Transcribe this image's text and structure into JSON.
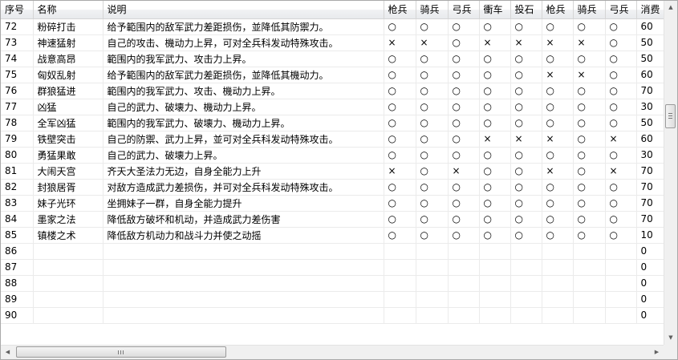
{
  "grid": {
    "columns": [
      "序号",
      "名称",
      "说明",
      "枪兵",
      "骑兵",
      "弓兵",
      "衝车",
      "投石",
      "枪兵",
      "骑兵",
      "弓兵",
      "消费"
    ],
    "rows": [
      [
        "72",
        "粉碎打击",
        "给予範围内的敌军武力差距损伤，並降低其防禦力。",
        "○",
        "○",
        "○",
        "○",
        "○",
        "○",
        "○",
        "○",
        "60"
      ],
      [
        "73",
        "神速猛射",
        "自己的攻击、機动力上昇，可对全兵科发动特殊攻击。",
        "×",
        "×",
        "○",
        "×",
        "×",
        "×",
        "×",
        "○",
        "50"
      ],
      [
        "74",
        "战意高昂",
        "範围内的我军武力、攻击力上昇。",
        "○",
        "○",
        "○",
        "○",
        "○",
        "○",
        "○",
        "○",
        "50"
      ],
      [
        "75",
        "匈奴乱射",
        "给予範围内的敌军武力差距损伤，並降低其機动力。",
        "○",
        "○",
        "○",
        "○",
        "○",
        "×",
        "×",
        "○",
        "60"
      ],
      [
        "76",
        "群狼猛进",
        "範围内的我军武力、攻击、機动力上昇。",
        "○",
        "○",
        "○",
        "○",
        "○",
        "○",
        "○",
        "○",
        "70"
      ],
      [
        "77",
        "凶猛",
        "自己的武力、破壊力、機动力上昇。",
        "○",
        "○",
        "○",
        "○",
        "○",
        "○",
        "○",
        "○",
        "30"
      ],
      [
        "78",
        "全军凶猛",
        "範围内的我军武力、破壊力、機动力上昇。",
        "○",
        "○",
        "○",
        "○",
        "○",
        "○",
        "○",
        "○",
        "50"
      ],
      [
        "79",
        "铁壁突击",
        "自己的防禦、武力上昇，並可对全兵科发动特殊攻击。",
        "○",
        "○",
        "○",
        "×",
        "×",
        "×",
        "○",
        "×",
        "60"
      ],
      [
        "80",
        "勇猛果敢",
        "自己的武力、破壊力上昇。",
        "○",
        "○",
        "○",
        "○",
        "○",
        "○",
        "○",
        "○",
        "30"
      ],
      [
        "81",
        "大闹天宫",
        "齐天大圣法力无边，自身全能力上升",
        "×",
        "○",
        "×",
        "○",
        "○",
        "×",
        "○",
        "×",
        "70"
      ],
      [
        "82",
        "封狼居胥",
        "对敌方造成武力差损伤，并可对全兵科发动特殊攻击。",
        "○",
        "○",
        "○",
        "○",
        "○",
        "○",
        "○",
        "○",
        "70"
      ],
      [
        "83",
        "妹子光环",
        "坐拥妹子一群，自身全能力提升",
        "○",
        "○",
        "○",
        "○",
        "○",
        "○",
        "○",
        "○",
        "70"
      ],
      [
        "84",
        "墨家之法",
        "降低敌方破坏和机动，并造成武力差伤害",
        "○",
        "○",
        "○",
        "○",
        "○",
        "○",
        "○",
        "○",
        "70"
      ],
      [
        "85",
        "镇楼之术",
        "降低敌方机动力和战斗力并使之动摇",
        "○",
        "○",
        "○",
        "○",
        "○",
        "○",
        "○",
        "○",
        "10"
      ],
      [
        "86",
        "",
        "",
        "",
        "",
        "",
        "",
        "",
        "",
        "",
        "",
        "0"
      ],
      [
        "87",
        "",
        "",
        "",
        "",
        "",
        "",
        "",
        "",
        "",
        "",
        "0"
      ],
      [
        "88",
        "",
        "",
        "",
        "",
        "",
        "",
        "",
        "",
        "",
        "",
        "0"
      ],
      [
        "89",
        "",
        "",
        "",
        "",
        "",
        "",
        "",
        "",
        "",
        "",
        "0"
      ],
      [
        "90",
        "",
        "",
        "",
        "",
        "",
        "",
        "",
        "",
        "",
        "",
        "0"
      ]
    ]
  },
  "scrollbars": {
    "up_arrow_icon": "▲",
    "down_arrow_icon": "▼",
    "left_arrow_icon": "◀",
    "right_arrow_icon": "▶"
  }
}
